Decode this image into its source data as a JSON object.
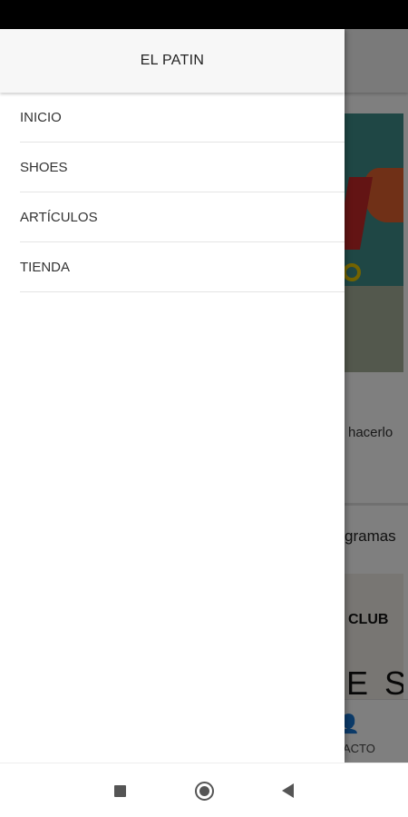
{
  "drawer": {
    "title": "EL PATIN",
    "items": [
      {
        "label": "INICIO"
      },
      {
        "label": "SHOES"
      },
      {
        "label": "ARTÍCULOS"
      },
      {
        "label": "TIENDA"
      }
    ]
  },
  "background": {
    "card_text": "hacerlo",
    "section_text": "gramas",
    "promo_club": "CLUB",
    "promo_letters": "E S",
    "nav_label": "ACTO",
    "nav_icon": "person-icon"
  },
  "system_nav": {
    "recents_icon": "square-icon",
    "home_icon": "circle-icon",
    "back_icon": "triangle-back-icon"
  },
  "colors": {
    "status_bar": "#000000",
    "drawer_header": "#f7f7f7",
    "scrim": "rgba(0,0,0,0.5)"
  }
}
